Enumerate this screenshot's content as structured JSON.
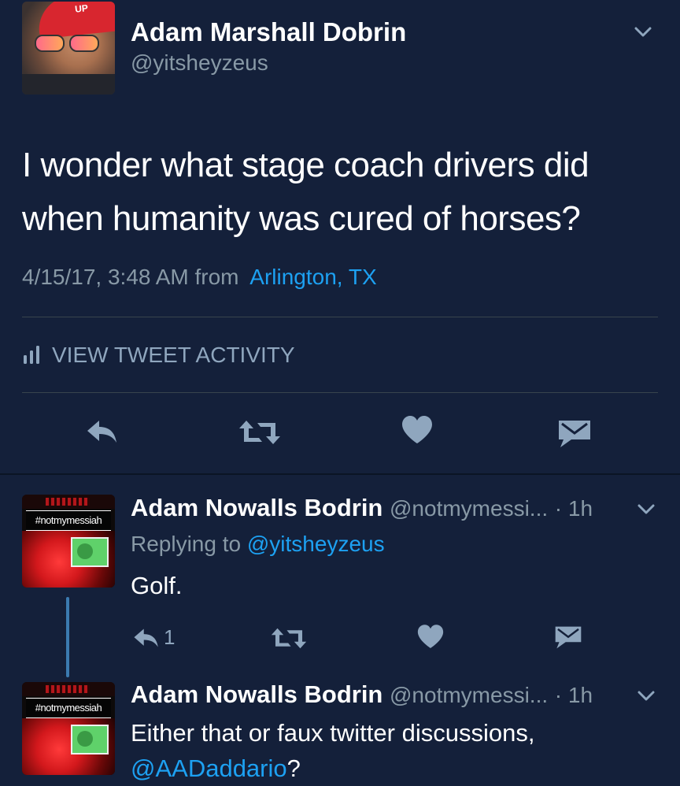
{
  "main_tweet": {
    "display_name": "Adam Marshall Dobrin",
    "handle": "@yitsheyzeus",
    "text_line1": "I wonder what stage coach drivers did",
    "text_line2": "when humanity was cured of horses?",
    "timestamp": "4/15/17, 3:48 AM",
    "from_label": "from",
    "location": "Arlington, TX",
    "activity_label": "VIEW TWEET ACTIVITY",
    "avatar_cap_text": "UP"
  },
  "replies": [
    {
      "display_name": "Adam Nowalls Bodrin",
      "handle": "@notmymessi...",
      "time": "· 1h",
      "replying_prefix": "Replying to",
      "replying_to": "@yitsheyzeus",
      "text": "Golf.",
      "reply_count": "1",
      "avatar_tag": "#notmymessiah"
    },
    {
      "display_name": "Adam Nowalls Bodrin",
      "handle": "@notmymessi...",
      "time": "· 1h",
      "text_line1": "Either that or faux twitter discussions,",
      "mention": "@AADaddario",
      "text_end": "?",
      "avatar_tag": "#notmymessiah"
    }
  ],
  "colors": {
    "background": "#14203a",
    "link": "#1da1f2",
    "muted": "#8899a6",
    "icon": "#8fa6be",
    "thread_line": "#3b7bb0"
  },
  "icons": {
    "reply": "reply-arrow-icon",
    "retweet": "retweet-icon",
    "like": "heart-icon",
    "dm": "envelope-icon",
    "menu": "chevron-down-icon",
    "activity": "bar-chart-icon"
  }
}
